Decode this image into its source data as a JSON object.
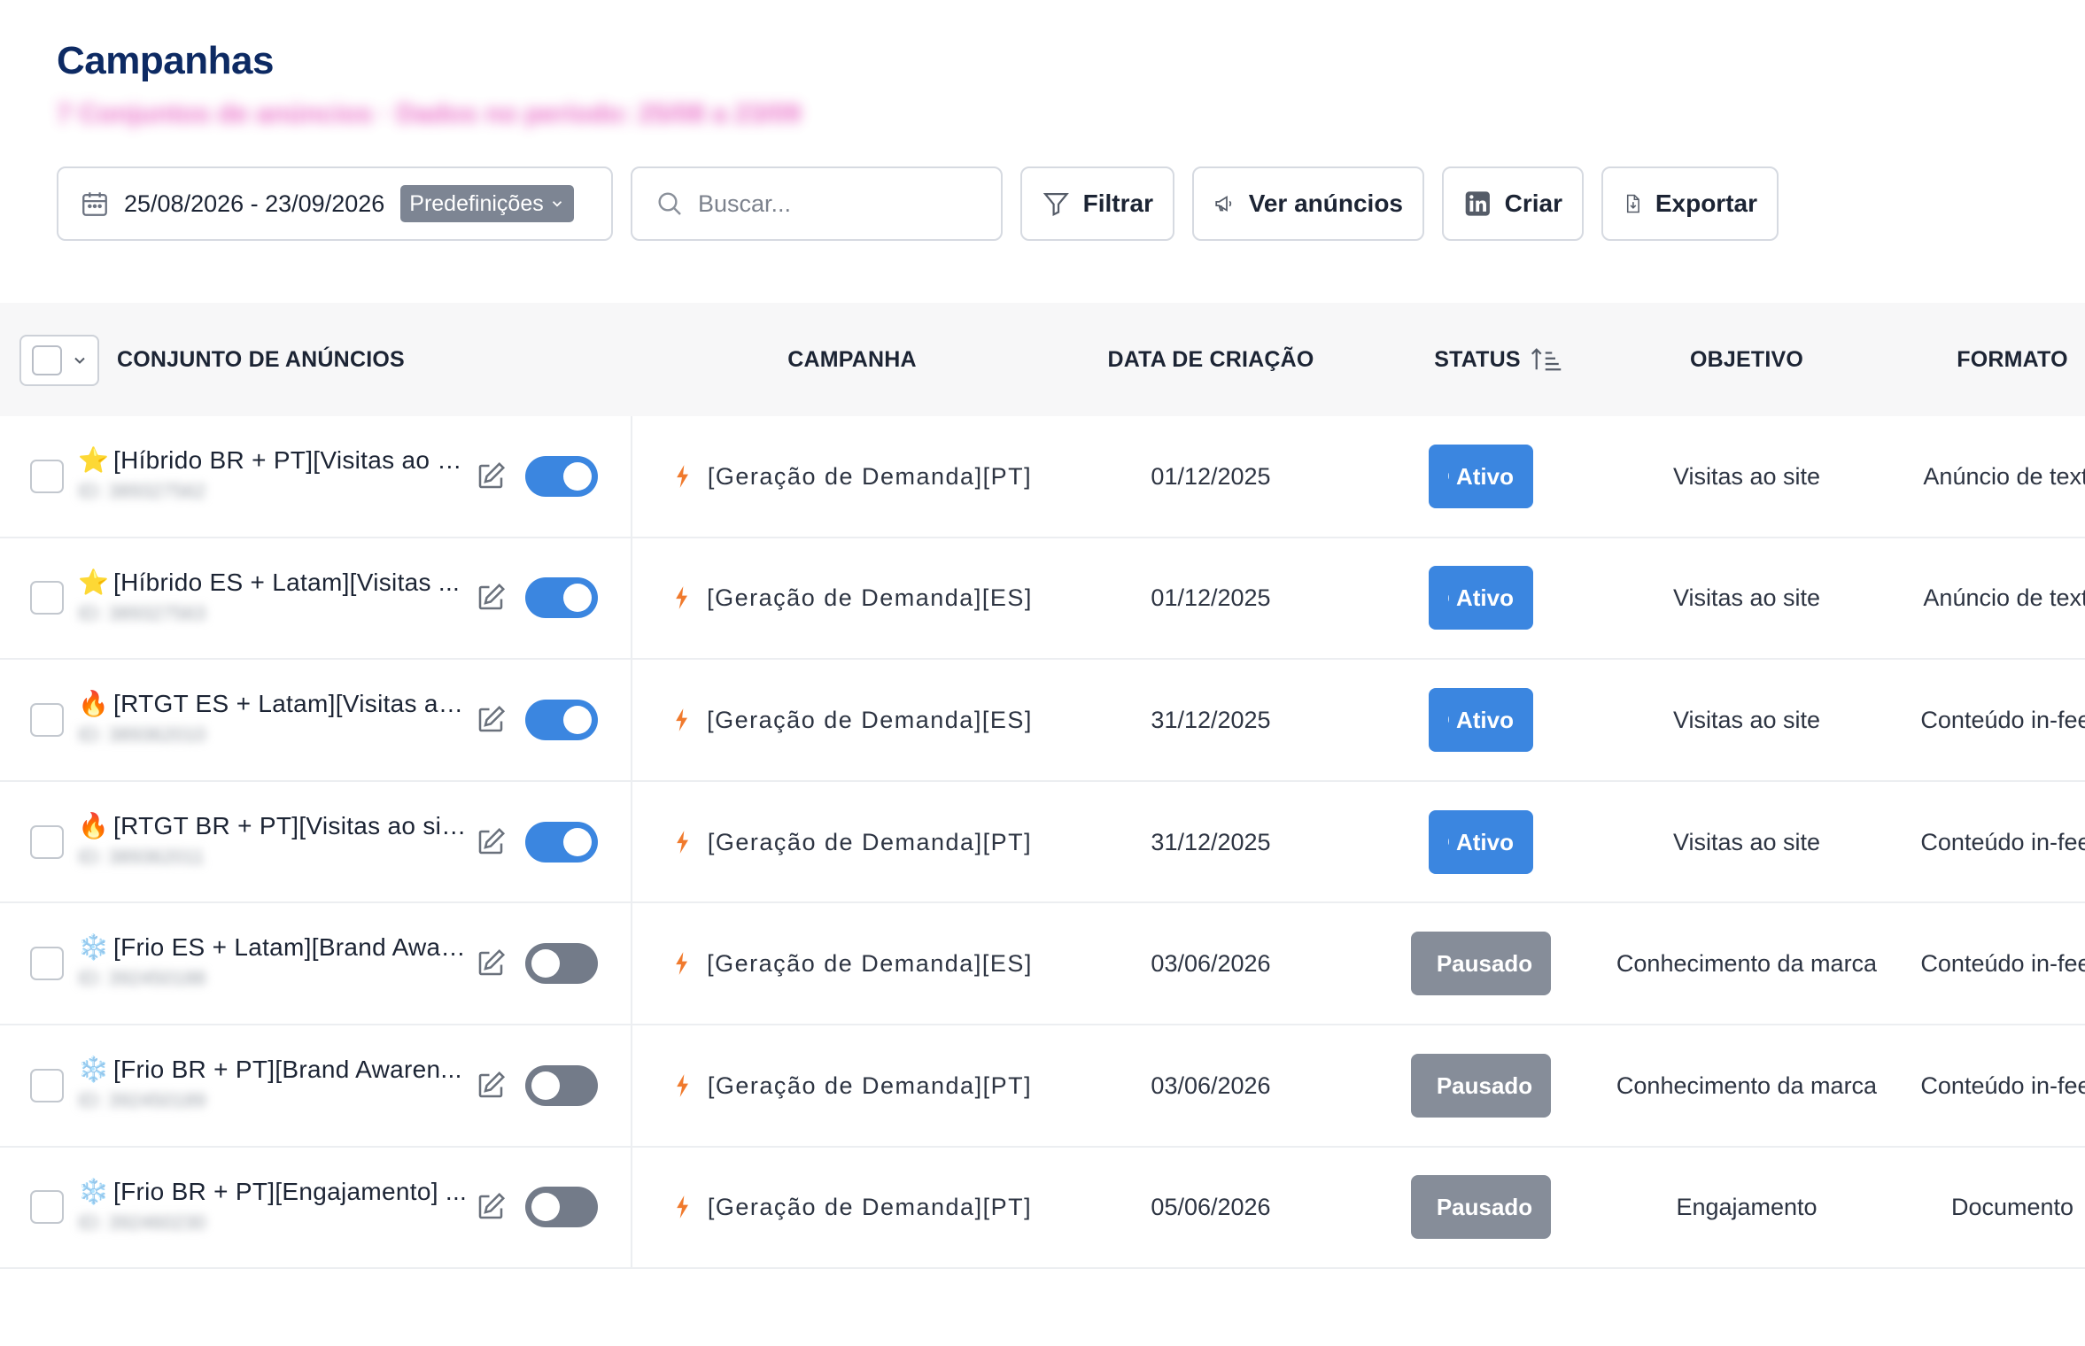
{
  "header": {
    "title": "Campanhas",
    "subtitle": "7 Conjuntos de anúncios · Dados no período: 25/08 a 23/09"
  },
  "toolbar": {
    "date_range": "25/08/2026 - 23/09/2026",
    "presets_label": "Predefinições",
    "search_placeholder": "Buscar...",
    "filter_label": "Filtrar",
    "view_ads_label": "Ver anúncios",
    "create_label": "Criar",
    "export_label": "Exportar"
  },
  "table": {
    "columns": {
      "ad_set": "CONJUNTO DE ANÚNCIOS",
      "campaign": "CAMPANHA",
      "created": "DATA DE CRIAÇÃO",
      "status": "STATUS",
      "objective": "OBJETIVO",
      "format": "FORMATO"
    },
    "rows": [
      {
        "icon": "⭐",
        "icon_name": "star-icon",
        "name": "[Híbrido BR + PT][Visitas ao s...",
        "id": "ID: 389327562",
        "active": true,
        "campaign": "[Geração de Demanda][PT]",
        "created": "01/12/2025",
        "status": "Ativo",
        "objective": "Visitas ao site",
        "format": "Anúncio de texto"
      },
      {
        "icon": "⭐",
        "icon_name": "star-icon",
        "name": "[Híbrido ES + Latam][Visitas ...",
        "id": "ID: 389327563",
        "active": true,
        "campaign": "[Geração de Demanda][ES]",
        "created": "01/12/2025",
        "status": "Ativo",
        "objective": "Visitas ao site",
        "format": "Anúncio de texto"
      },
      {
        "icon": "🔥",
        "icon_name": "fire-icon",
        "name": "[RTGT ES + Latam][Visitas ao...",
        "id": "ID: 389362010",
        "active": true,
        "campaign": "[Geração de Demanda][ES]",
        "created": "31/12/2025",
        "status": "Ativo",
        "objective": "Visitas ao site",
        "format": "Conteúdo in-feed"
      },
      {
        "icon": "🔥",
        "icon_name": "fire-icon",
        "name": "[RTGT BR + PT][Visitas ao sit...",
        "id": "ID: 389362011",
        "active": true,
        "campaign": "[Geração de Demanda][PT]",
        "created": "31/12/2025",
        "status": "Ativo",
        "objective": "Visitas ao site",
        "format": "Conteúdo in-feed"
      },
      {
        "icon": "❄️",
        "icon_name": "snowflake-icon",
        "name": "[Frio ES + Latam][Brand Awar...",
        "id": "ID: 392450188",
        "active": false,
        "campaign": "[Geração de Demanda][ES]",
        "created": "03/06/2026",
        "status": "Pausado",
        "objective": "Conhecimento da marca",
        "format": "Conteúdo in-feed"
      },
      {
        "icon": "❄️",
        "icon_name": "snowflake-icon",
        "name": "[Frio BR + PT][Brand Awaren...",
        "id": "ID: 392450189",
        "active": false,
        "campaign": "[Geração de Demanda][PT]",
        "created": "03/06/2026",
        "status": "Pausado",
        "objective": "Conhecimento da marca",
        "format": "Conteúdo in-feed"
      },
      {
        "icon": "❄️",
        "icon_name": "snowflake-icon",
        "name": "[Frio BR + PT][Engajamento] ...",
        "id": "ID: 392460230",
        "active": false,
        "campaign": "[Geração de Demanda][PT]",
        "created": "05/06/2026",
        "status": "Pausado",
        "objective": "Engajamento",
        "format": "Documento"
      }
    ]
  },
  "colors": {
    "title": "#0d2a63",
    "active": "#3b86e0",
    "paused": "#868d99",
    "bolt": "#f07a2d"
  }
}
